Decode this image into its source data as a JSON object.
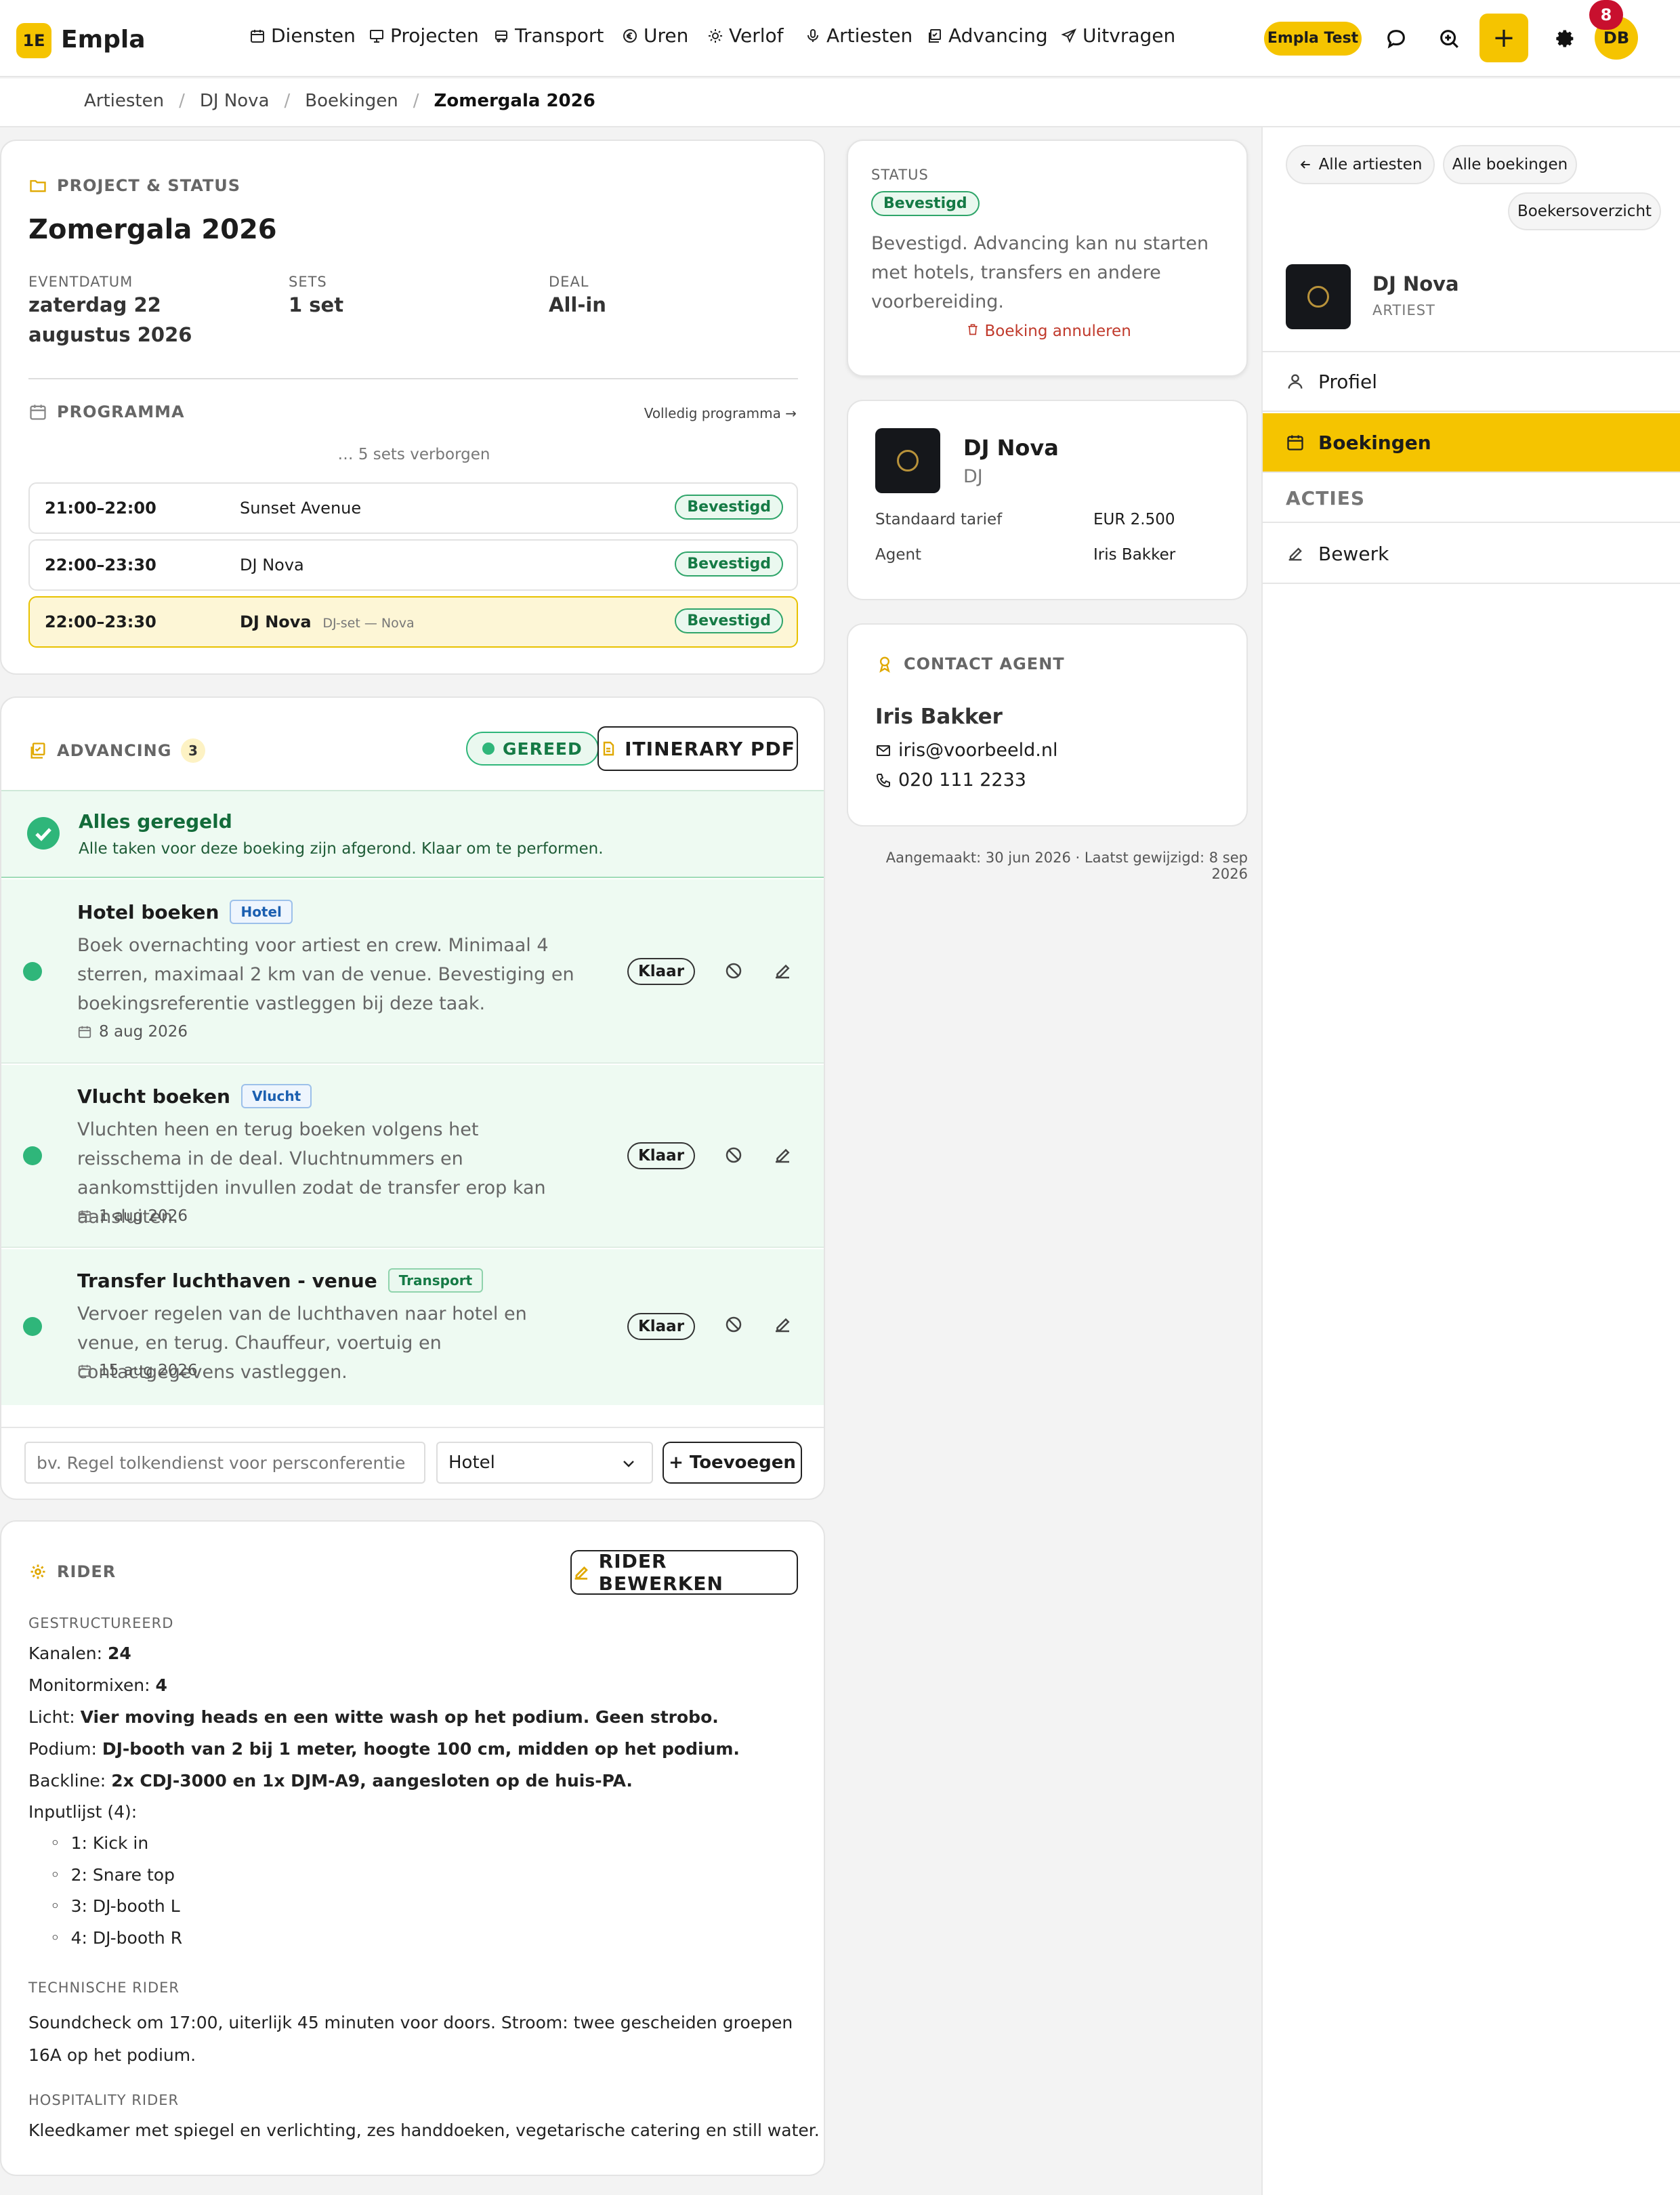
{
  "app": {
    "logo": "1E",
    "name": "Empla",
    "env_badge": "Empla Test",
    "user_initials": "DB",
    "notification_count": "8"
  },
  "nav": [
    {
      "label": "Diensten",
      "icon": "calendar-icon"
    },
    {
      "label": "Projecten",
      "icon": "monitor-icon"
    },
    {
      "label": "Transport",
      "icon": "bus-icon"
    },
    {
      "label": "Uren",
      "icon": "euro-icon"
    },
    {
      "label": "Verlof",
      "icon": "sun-icon"
    },
    {
      "label": "Artiesten",
      "icon": "microphone-icon"
    },
    {
      "label": "Advancing",
      "icon": "checklist-icon"
    },
    {
      "label": "Uitvragen",
      "icon": "send-icon"
    }
  ],
  "breadcrumb": [
    "Artiesten",
    "DJ Nova",
    "Boekingen",
    "Zomergala 2026"
  ],
  "project": {
    "section": "PROJECT & STATUS",
    "title": "Zomergala 2026",
    "fields": [
      {
        "label": "EVENTDATUM",
        "value": "zaterdag 22 augustus 2026"
      },
      {
        "label": "SETS",
        "value": "1 set"
      },
      {
        "label": "DEAL",
        "value": "All-in"
      }
    ],
    "programma_label": "PROGRAMMA",
    "programma_link": "Volledig programma →",
    "hidden_sets": "… 5 sets verborgen",
    "rows": [
      {
        "time": "21:00–22:00",
        "artist": "Sunset Avenue",
        "sub": "",
        "status": "Bevestigd"
      },
      {
        "time": "22:00–23:30",
        "artist": "DJ Nova",
        "sub": "",
        "status": "Bevestigd"
      },
      {
        "time": "22:00–23:30",
        "artist": "DJ Nova",
        "sub": "DJ-set — Nova",
        "status": "Bevestigd"
      }
    ]
  },
  "advancing": {
    "section": "ADVANCING",
    "count": "3",
    "ready": "GEREED",
    "pdf": "ITINERARY PDF",
    "done_title": "Alles geregeld",
    "done_sub": "Alle taken voor deze boeking zijn afgerond. Klaar om te performen.",
    "tasks": [
      {
        "title": "Hotel boeken",
        "tag": "Hotel",
        "desc": "Boek overnachting voor artiest en crew. Minimaal 4 sterren, maximaal 2 km van de venue. Bevestiging en boekingsreferentie vastleggen bij deze taak.",
        "date": "8 aug 2026",
        "state": "Klaar"
      },
      {
        "title": "Vlucht boeken",
        "tag": "Vlucht",
        "desc": "Vluchten heen en terug boeken volgens het reisschema in de deal. Vluchtnummers en aankomsttijden invullen zodat de transfer erop kan aansluiten.",
        "date": "1 aug 2026",
        "state": "Klaar"
      },
      {
        "title": "Transfer luchthaven - venue",
        "tag": "Transport",
        "desc": "Vervoer regelen van de luchthaven naar hotel en venue, en terug. Chauffeur, voertuig en contactgegevens vastleggen.",
        "date": "15 aug 2026",
        "state": "Klaar"
      }
    ],
    "input_placeholder": "bv. Regel tolkendienst voor persconferentie",
    "select_value": "Hotel",
    "add_button": "+ Toevoegen"
  },
  "rider": {
    "section": "RIDER",
    "edit": "RIDER BEWERKEN",
    "structured_label": "GESTRUCTUREERD",
    "lines": [
      {
        "k": "Kanalen: ",
        "v": "24"
      },
      {
        "k": "Monitormixen: ",
        "v": "4"
      },
      {
        "k": "Licht: ",
        "v": "Vier moving heads en een witte wash op het podium. Geen strobo."
      },
      {
        "k": "Podium: ",
        "v": "DJ-booth van 2 bij 1 meter, hoogte 100 cm, midden op het podium."
      },
      {
        "k": "Backline: ",
        "v": "2x CDJ-3000 en 1x DJM-A9, aangesloten op de huis-PA."
      }
    ],
    "inputlist_label": "Inputlijst (4):",
    "inputs": [
      "1: Kick in",
      "2: Snare top",
      "3: DJ-booth L",
      "4: DJ-booth R"
    ],
    "tech_label": "TECHNISCHE RIDER",
    "tech_text": "Soundcheck om 17:00, uiterlijk 45 minuten voor doors. Stroom: twee gescheiden groepen 16A op het podium.",
    "hosp_label": "HOSPITALITY RIDER",
    "hosp_text": "Kleedkamer met spiegel en verlichting, zes handdoeken, vegetarische catering en still water."
  },
  "status": {
    "label": "STATUS",
    "chip": "Bevestigd",
    "text": "Bevestigd. Advancing kan nu starten met hotels, transfers en andere voorbereiding.",
    "cancel": "Boeking annuleren"
  },
  "artist_card": {
    "name": "DJ Nova",
    "type": "DJ",
    "rate_label": "Standaard tarief",
    "rate": "EUR 2.500",
    "agent_label": "Agent",
    "agent": "Iris Bakker"
  },
  "contact": {
    "label": "CONTACT AGENT",
    "name": "Iris Bakker",
    "email": "iris@voorbeeld.nl",
    "phone": "020 111 2233"
  },
  "meta": "Aangemaakt: 30 jun 2026 · Laatst gewijzigd: 8 sep 2026",
  "sidebar": {
    "btn_artists": "Alle artiesten",
    "btn_bookings": "Alle boekingen",
    "btn_overview": "Boekersoverzicht",
    "name": "DJ Nova",
    "role": "ARTIEST",
    "items": [
      {
        "label": "Profiel"
      },
      {
        "label": "Boekingen"
      }
    ],
    "actions_label": "ACTIES",
    "edit": "Bewerk"
  },
  "colors": {
    "accent": "#f5c400",
    "success": "#2fb67a",
    "success_bg": "#eefaf2",
    "danger": "#c0392b"
  }
}
